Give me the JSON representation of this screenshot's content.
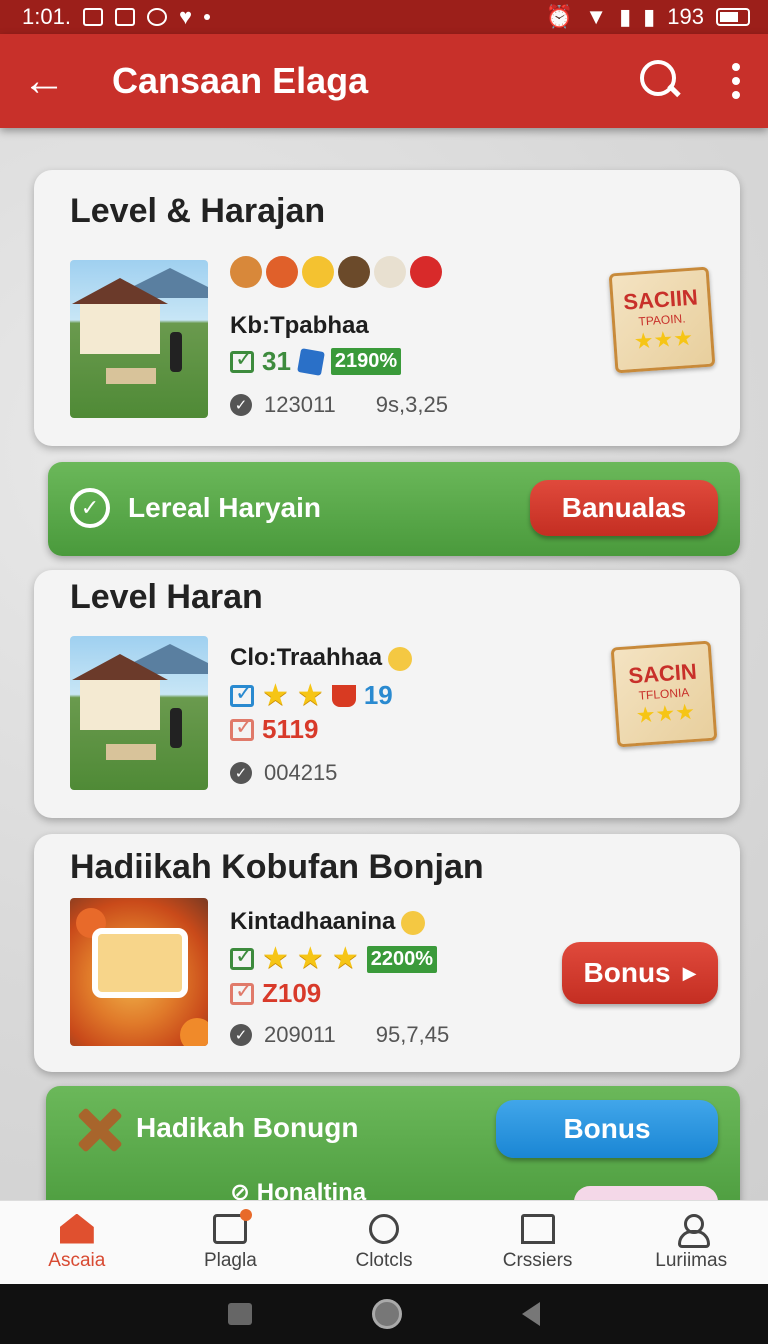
{
  "status_bar": {
    "time": "1:01.",
    "battery": "193"
  },
  "app_bar": {
    "title": "Cansaan Elaga"
  },
  "cards": [
    {
      "title": "Level & Harajan",
      "subtitle": "Kb:Tpabhaa",
      "stat_value": "31",
      "stat_pct": "2190%",
      "meta_a": "123011",
      "meta_b": "9s,3,25",
      "badge_line1": "SACIIN",
      "badge_line2": "TPAOIN."
    },
    {
      "title": "Level Haran",
      "subtitle": "Clo:Traahhaa",
      "stat_value": "19",
      "stat_value2": "5119",
      "meta_a": "004215",
      "badge_line1": "SACIN",
      "badge_line2": "TFLONIA"
    },
    {
      "title": "Hadiikah Kobufan Bonjan",
      "subtitle": "Kintadhaanina",
      "stat_pct": "2200%",
      "stat_value2": "Z109",
      "meta_a": "209011",
      "meta_b": "95,7,45",
      "button": "Bonus"
    }
  ],
  "banner1": {
    "label": "Lereal Haryain",
    "button": "Banualas"
  },
  "banner2": {
    "label": "Hadikah Bonugn",
    "button": "Bonus",
    "sub_label": "Honaltina"
  },
  "bottom_nav": [
    {
      "label": "Ascaia",
      "icon": "home-icon",
      "active": true
    },
    {
      "label": "Plagla",
      "icon": "box-icon",
      "active": false
    },
    {
      "label": "Clotcls",
      "icon": "ring-icon",
      "active": false
    },
    {
      "label": "Crssiers",
      "icon": "bank-icon",
      "active": false
    },
    {
      "label": "Luriimas",
      "icon": "person-icon",
      "active": false
    }
  ],
  "colors": {
    "status_bar": "#9c1f1a",
    "app_bar": "#c8302a",
    "green_banner": "#4a9a3c",
    "red_button": "#c42e22",
    "blue_button": "#1a86d4",
    "nav_active": "#d84a32"
  }
}
